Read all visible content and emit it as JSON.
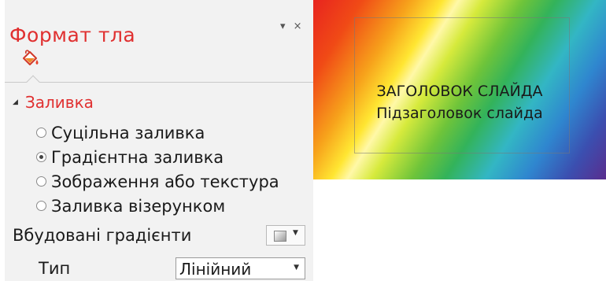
{
  "pane": {
    "title": "Формат тла",
    "pin_glyph": "▾",
    "close_glyph": "×",
    "icons": [
      "paint-bucket-icon",
      "chevron-down-icon",
      "close-icon",
      "collapse-triangle-icon",
      "gradient-preset-icon"
    ]
  },
  "fill_section": {
    "heading": "Заливка",
    "expanded": true,
    "options": [
      {
        "label": "Суцільна заливка",
        "selected": false
      },
      {
        "label": "Градієнтна заливка",
        "selected": true
      },
      {
        "label": "Зображення або текстура",
        "selected": false
      },
      {
        "label": "Заливка візерунком",
        "selected": false
      }
    ]
  },
  "preset_gradients": {
    "label": "Вбудовані градієнти"
  },
  "gradient_type": {
    "label": "Тип",
    "value": "Лінійний"
  },
  "slide": {
    "title": "ЗАГОЛОВОК СЛАЙДА",
    "subtitle": "Підзаголовок слайда",
    "gradient_colors": [
      "#e8241f",
      "#f7a21b",
      "#ffe632",
      "#6ec43a",
      "#33b6c4",
      "#2f86cf",
      "#5a2d8e"
    ]
  },
  "colors": {
    "accent": "#e03030",
    "pane_bg": "#f2f2f2"
  }
}
